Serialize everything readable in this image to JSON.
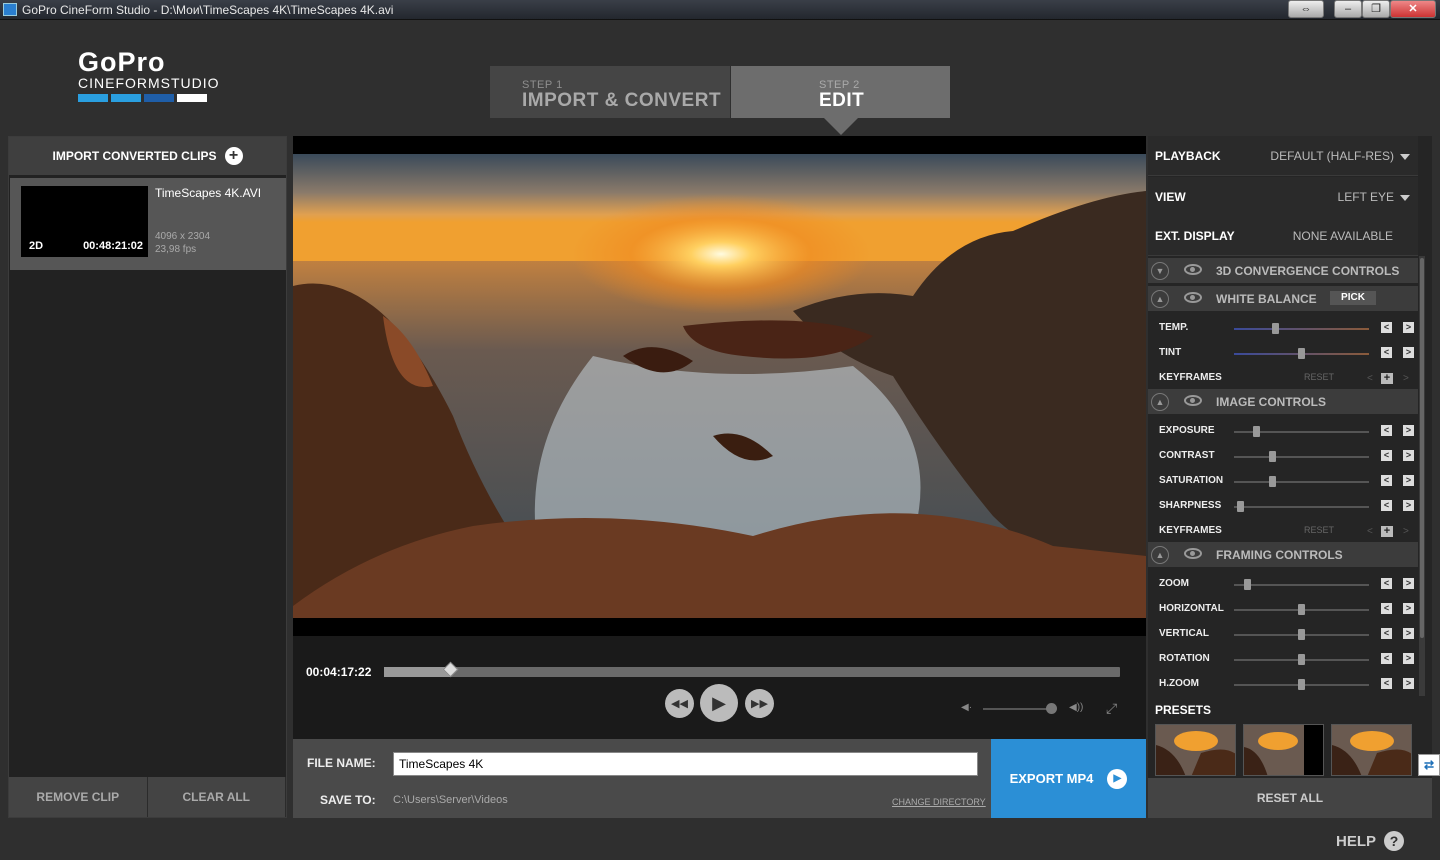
{
  "window": {
    "title": "GoPro CineForm Studio - D:\\Мои\\TimeScapes 4K\\TimeScapes 4K.avi"
  },
  "logo": {
    "brand": "GoPro",
    "product": "CINEFORMSTUDIO",
    "bar_colors": [
      "#2a9fe0",
      "#2a9fe0",
      "#1f5ea8",
      "#ffffff"
    ]
  },
  "steps": [
    {
      "number": "STEP 1",
      "name": "IMPORT & CONVERT",
      "active": false
    },
    {
      "number": "STEP 2",
      "name": "EDIT",
      "active": true
    }
  ],
  "clips_panel": {
    "import_label": "IMPORT CONVERTED CLIPS",
    "clips": [
      {
        "name": "TimeScapes 4K.AVI",
        "mode": "2D",
        "duration": "00:48:21:02",
        "resolution": "4096 x 2304",
        "fps": "23,98 fps"
      }
    ],
    "remove_label": "REMOVE CLIP",
    "clear_label": "CLEAR ALL"
  },
  "player": {
    "timecode": "00:04:17:22",
    "position": 0.09,
    "volume": 0.95
  },
  "output": {
    "file_name_label": "FILE NAME:",
    "file_name_value": "TimeScapes 4K",
    "save_to_label": "SAVE TO:",
    "save_path": "C:\\Users\\Server\\Videos",
    "change_dir_label": "CHANGE DIRECTORY",
    "export_label": "EXPORT MP4"
  },
  "settings": {
    "playback": {
      "label": "PLAYBACK",
      "value": "DEFAULT (HALF-RES)"
    },
    "view": {
      "label": "VIEW",
      "value": "LEFT EYE"
    },
    "ext_display": {
      "label": "EXT. DISPLAY",
      "value": "NONE AVAILABLE"
    }
  },
  "sections": {
    "convergence": {
      "label": "3D CONVERGENCE CONTROLS"
    },
    "white_balance": {
      "label": "WHITE BALANCE",
      "pick_label": "PICK",
      "controls": [
        {
          "name": "TEMP.",
          "value": 0.3
        },
        {
          "name": "TINT",
          "value": 0.5
        }
      ],
      "keyframes_label": "KEYFRAMES",
      "reset_label": "RESET"
    },
    "image": {
      "label": "IMAGE CONTROLS",
      "controls": [
        {
          "name": "EXPOSURE",
          "value": 0.15
        },
        {
          "name": "CONTRAST",
          "value": 0.27
        },
        {
          "name": "SATURATION",
          "value": 0.27
        },
        {
          "name": "SHARPNESS",
          "value": 0.02
        }
      ],
      "keyframes_label": "KEYFRAMES",
      "reset_label": "RESET"
    },
    "framing": {
      "label": "FRAMING CONTROLS",
      "controls": [
        {
          "name": "ZOOM",
          "value": 0.08
        },
        {
          "name": "HORIZONTAL",
          "value": 0.5
        },
        {
          "name": "VERTICAL",
          "value": 0.5
        },
        {
          "name": "ROTATION",
          "value": 0.5
        },
        {
          "name": "H.ZOOM",
          "value": 0.5
        }
      ]
    }
  },
  "presets": {
    "label": "PRESETS"
  },
  "reset_all_label": "RESET ALL",
  "help_label": "HELP"
}
